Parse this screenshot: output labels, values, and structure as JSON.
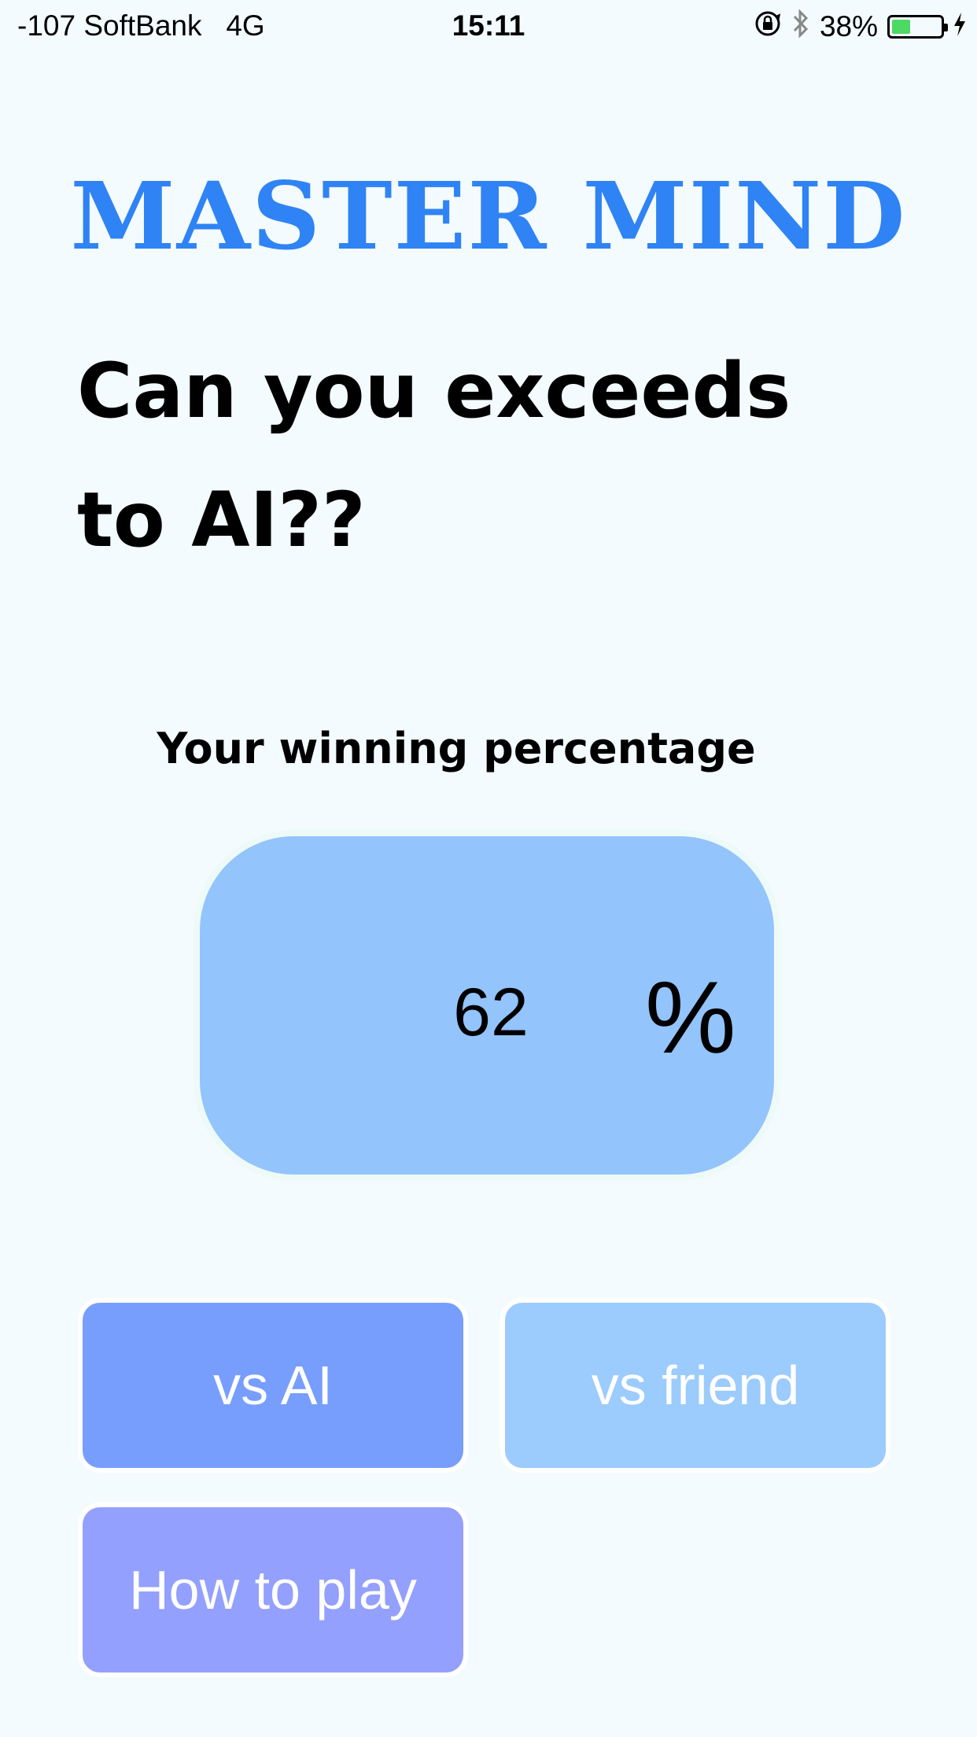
{
  "status_bar": {
    "carrier": "-107 SoftBank   4G",
    "time": "15:11",
    "battery_percent": "38%",
    "battery_level": 0.38,
    "icons": [
      "orientation-lock-icon",
      "bluetooth-icon",
      "battery-icon",
      "charging-bolt-icon"
    ]
  },
  "header": {
    "title": "MASTER MIND"
  },
  "tagline": {
    "line1": "Can you exceeds",
    "line2": "to AI??"
  },
  "stats": {
    "label": "Your winning percentage",
    "value": "62",
    "unit": "%"
  },
  "buttons": {
    "vs_ai": "vs AI",
    "vs_friend": "vs friend",
    "how_to_play": "How to play"
  },
  "colors": {
    "title": "#2f83f4",
    "card": "#93c4fc",
    "vs_ai": "#779efd",
    "vs_friend": "#9ccbfd",
    "how_to_play": "#93a0fd",
    "background": "#f3fbff"
  }
}
